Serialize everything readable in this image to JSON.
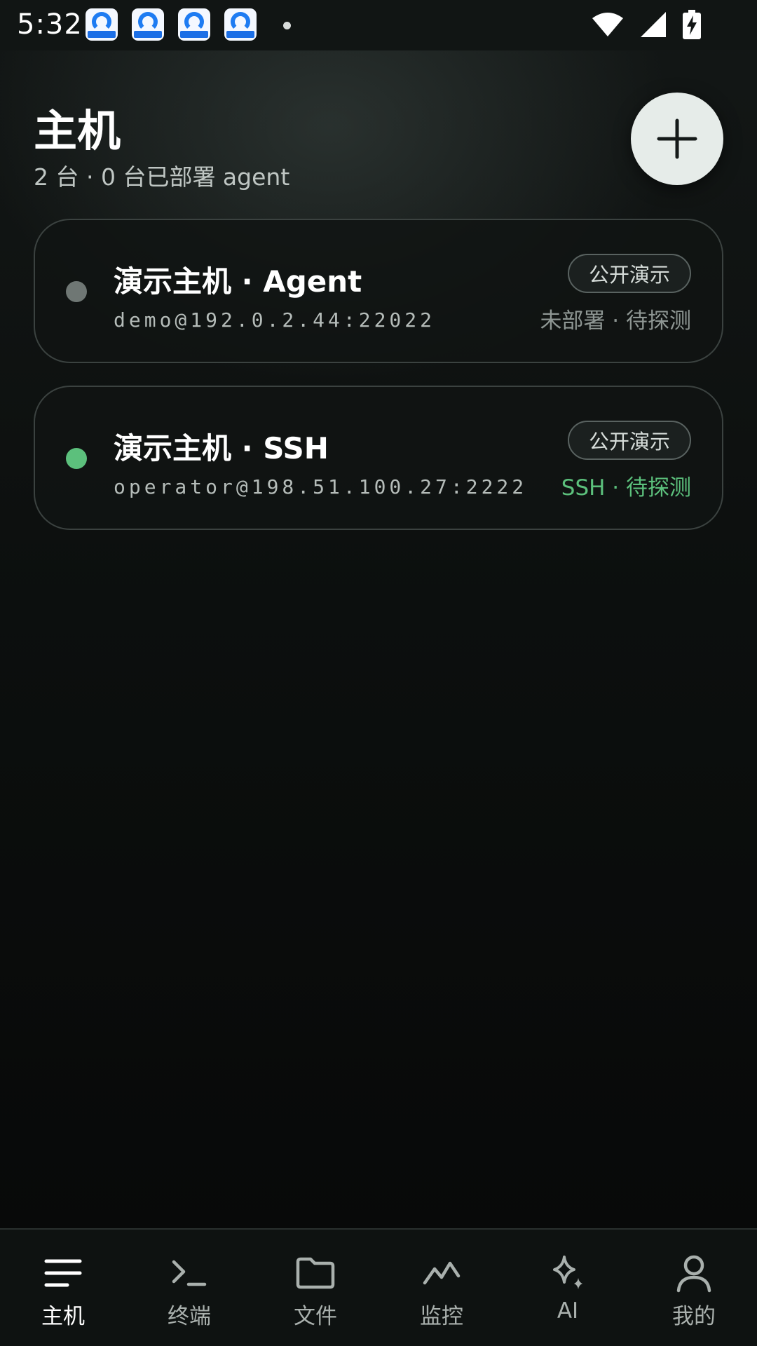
{
  "status_bar": {
    "time": "5:32",
    "notification_apps": [
      "app-icon",
      "app-icon",
      "app-icon",
      "app-icon"
    ],
    "icons": [
      "wifi-icon",
      "signal-icon",
      "battery-charging-icon"
    ]
  },
  "header": {
    "title": "主机",
    "subtitle": "2 台 · 0 台已部署 agent",
    "add_button_icon": "plus-icon"
  },
  "hosts": [
    {
      "name": "演示主机 · Agent",
      "address": "demo@192.0.2.44:22022",
      "badge": "公开演示",
      "state": "未部署 · 待探测",
      "status_color": "#6f7774",
      "state_color": "#8e9693"
    },
    {
      "name": "演示主机 · SSH",
      "address": "operator@198.51.100.27:2222",
      "badge": "公开演示",
      "state": "SSH · 待探测",
      "status_color": "#5cc07c",
      "state_color": "#5cc07c"
    }
  ],
  "nav": {
    "active": "主机",
    "items": [
      {
        "label": "主机",
        "icon": "menu-lines-icon"
      },
      {
        "label": "终端",
        "icon": "terminal-icon"
      },
      {
        "label": "文件",
        "icon": "folder-icon"
      },
      {
        "label": "监控",
        "icon": "chart-line-icon"
      },
      {
        "label": "AI",
        "icon": "sparkle-icon"
      },
      {
        "label": "我的",
        "icon": "person-icon"
      }
    ]
  }
}
